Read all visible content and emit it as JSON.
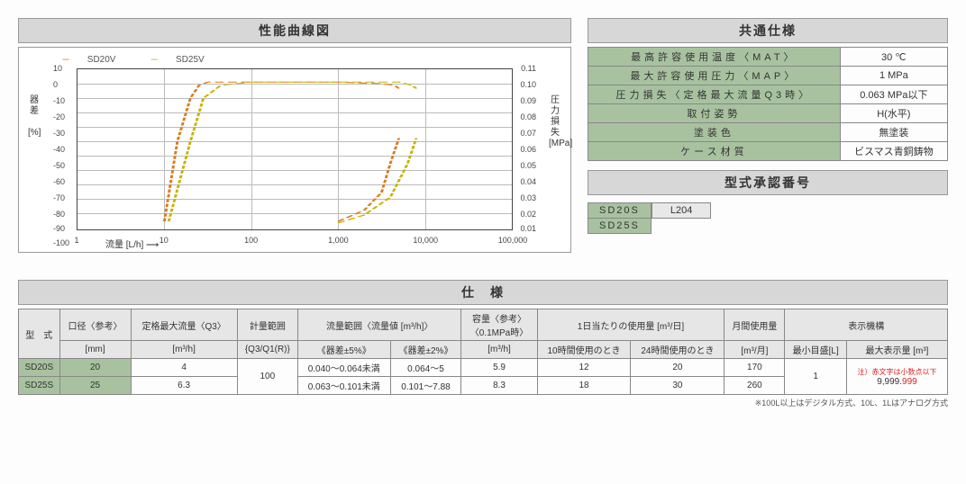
{
  "titles": {
    "chart": "性能曲線図",
    "common_spec": "共通仕様",
    "approval": "型式承認番号",
    "spec": "仕　様"
  },
  "chart": {
    "legend": {
      "sd20v": "SD20V",
      "sd25v": "SD25V"
    },
    "y_left_label": "器差",
    "y_left_unit": "[%]",
    "y_right_label": "圧力損失",
    "y_right_unit": "[MPa]",
    "x_label": "流量 [L/h] ⟶",
    "y_left_ticks": [
      "10",
      "0",
      "-10",
      "-20",
      "-30",
      "-40",
      "-50",
      "-60",
      "-70",
      "-80",
      "-90",
      "-100"
    ],
    "y_right_ticks": [
      "0.11",
      "0.10",
      "0.09",
      "0.08",
      "0.07",
      "0.06",
      "0.05",
      "0.04",
      "0.03",
      "0.02",
      "0.01",
      ""
    ],
    "x_ticks": [
      "1",
      "10",
      "100",
      "1,000",
      "10,000",
      "100,000"
    ]
  },
  "chart_data": {
    "type": "line",
    "x_scale": "log",
    "xlim": [
      1,
      100000
    ],
    "y_left_lim": [
      -100,
      10
    ],
    "y_right_lim": [
      0,
      0.11
    ],
    "x_label": "流量 [L/h]",
    "y_left_label": "器差 [%]",
    "y_right_label": "圧力損失 [MPa]",
    "series": [
      {
        "name": "SD20V 器差",
        "axis": "left",
        "style": "dashed",
        "color": "#d97a1a",
        "x": [
          10,
          15,
          20,
          30,
          40,
          100,
          1000,
          3000,
          4000,
          5000
        ],
        "y": [
          -95,
          -40,
          -10,
          0,
          2,
          2,
          2,
          1,
          0,
          -2
        ]
      },
      {
        "name": "SD25V 器差",
        "axis": "left",
        "style": "dashed",
        "color": "#c4b200",
        "x": [
          12,
          20,
          30,
          50,
          100,
          1000,
          5000,
          7000,
          7880
        ],
        "y": [
          -95,
          -40,
          -10,
          0,
          2,
          2,
          2,
          0,
          -2
        ]
      },
      {
        "name": "SD20V 圧力損失",
        "axis": "right",
        "style": "dashed",
        "color": "#d97a1a",
        "x": [
          1000,
          2000,
          3000,
          4000,
          5000
        ],
        "y": [
          0.005,
          0.012,
          0.025,
          0.045,
          0.063
        ]
      },
      {
        "name": "SD25V 圧力損失",
        "axis": "right",
        "style": "dashed",
        "color": "#c4b200",
        "x": [
          1000,
          2000,
          4000,
          6000,
          7880
        ],
        "y": [
          0.004,
          0.01,
          0.022,
          0.045,
          0.063
        ]
      }
    ]
  },
  "common_spec": [
    {
      "k": "最高許容使用温度〈MAT〉",
      "v": "30 ℃"
    },
    {
      "k": "最大許容使用圧力〈MAP〉",
      "v": "1 MPa"
    },
    {
      "k": "圧力損失〈定格最大流量Q3時〉",
      "v": "0.063 MPa以下"
    },
    {
      "k": "取付姿勢",
      "v": "H(水平)"
    },
    {
      "k": "塗装色",
      "v": "無塗装"
    },
    {
      "k": "ケース材質",
      "v": "ビスマス青銅鋳物"
    }
  ],
  "approval": {
    "models": [
      "SD20S",
      "SD25S"
    ],
    "number": "L204"
  },
  "big_spec": {
    "headers": {
      "model": "型　式",
      "bore": "口径〈参考〉",
      "bore_unit": "[mm]",
      "q3": "定格最大流量〈Q3〉",
      "q3_unit": "[m³/h]",
      "range": "計量範囲",
      "range_sub": "{Q3/Q1(R)}",
      "flow_range": "流量範囲〈流量値 [m³/h]〉",
      "err5": "《器差±5%》",
      "err2": "《器差±2%》",
      "capacity": "容量〈参考〉",
      "capacity_sub": "〈0.1MPa時〉",
      "capacity_unit": "[m³/h]",
      "daily": "1日当たりの使用量 [m³/日]",
      "daily10": "10時間使用のとき",
      "daily24": "24時間使用のとき",
      "monthly": "月間使用量",
      "monthly_unit": "[m³/月]",
      "display": "表示機構",
      "min_scale": "最小目盛[L]",
      "max_display": "最大表示量 [m³]",
      "max_display_note": "注）赤文字は小数点以下",
      "max_display_val_int": "9,999.",
      "max_display_val_dec": "999"
    },
    "rows": [
      {
        "model": "SD20S",
        "bore": "20",
        "q3": "4",
        "err5": "0.040～0.064未満",
        "err2": "0.064～5",
        "cap": "5.9",
        "d10": "12",
        "d24": "20",
        "monthly": "170"
      },
      {
        "model": "SD25S",
        "bore": "25",
        "q3": "6.3",
        "err5": "0.063～0.101未満",
        "err2": "0.101～7.88",
        "cap": "8.3",
        "d10": "18",
        "d24": "30",
        "monthly": "260"
      }
    ],
    "range_shared": "100",
    "min_scale_shared": "1",
    "footnote": "※100L以上はデジタル方式、10L、1Lはアナログ方式"
  }
}
